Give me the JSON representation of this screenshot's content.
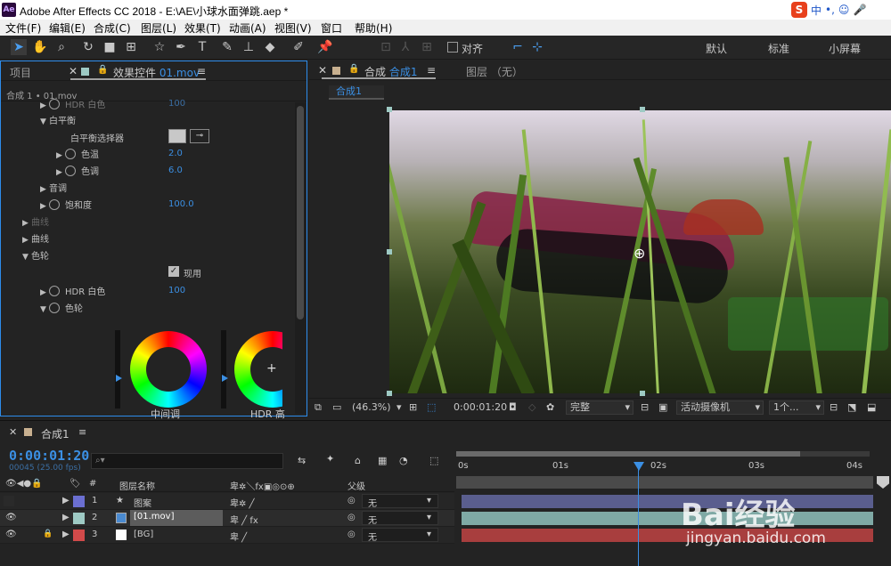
{
  "window": {
    "title": "Adobe After Effects CC 2018 - E:\\AE\\小球水面弹跳.aep *",
    "app_badge": "Ae",
    "ime": {
      "logo": "S",
      "lang": "中",
      "punct": "•,",
      "emoji": "☺",
      "mic": "🎤"
    }
  },
  "menu": [
    "文件(F)",
    "编辑(E)",
    "合成(C)",
    "图层(L)",
    "效果(T)",
    "动画(A)",
    "视图(V)",
    "窗口",
    "帮助(H)"
  ],
  "toolbar": {
    "align_label": "对齐",
    "workspaces": [
      "默认",
      "标准",
      "小屏幕"
    ]
  },
  "left_panel": {
    "tabs": [
      "项目",
      "效果控件 01.mov"
    ],
    "effect_tab_prefix": "效果控件",
    "effect_tab_file": "01.mov",
    "subtitle": "合成 1 • 01.mov",
    "props": [
      {
        "label": "HDR 白色",
        "value": "100"
      },
      {
        "label": "白平衡",
        "value": ""
      },
      {
        "label": "白平衡选择器",
        "value": ""
      },
      {
        "label": "色温",
        "value": "2.0"
      },
      {
        "label": "色调",
        "value": "6.0"
      },
      {
        "label": "音调",
        "value": ""
      },
      {
        "label": "饱和度",
        "value": "100.0"
      },
      {
        "label": "曲线",
        "value": ""
      },
      {
        "label": "曲线",
        "value": ""
      },
      {
        "label": "色轮",
        "value": ""
      },
      {
        "label": "现用",
        "value": ""
      },
      {
        "label": "HDR 白色",
        "value": "100"
      },
      {
        "label": "色轮",
        "value": ""
      }
    ],
    "wheel_labels": [
      "中间调",
      "HDR 高"
    ]
  },
  "comp_panel": {
    "tab_prefix": "合成",
    "tab_name": "合成1",
    "layer_tab": "图层 （无）",
    "subtab": "合成1",
    "zoom": "(46.3%)",
    "timecode": "0:00:01:20",
    "quality": "完整",
    "camera": "活动摄像机",
    "views": "1个..."
  },
  "timeline": {
    "tab": "合成1",
    "timecode": "0:00:01:20",
    "frames": "00045 (25.00 fps)",
    "search_placeholder": "",
    "col_name": "图层名称",
    "col_parent": "父级",
    "col_num": "#",
    "ruler": [
      "0s",
      "01s",
      "02s",
      "03s",
      "04s"
    ],
    "layers": [
      {
        "num": "1",
        "name": "图案",
        "parent": "无",
        "color": "#6b6fd1",
        "bar": "#5a5e8e"
      },
      {
        "num": "2",
        "name": "[01.mov]",
        "parent": "无",
        "color": "#9ecac4",
        "bar": "#7fa9a5"
      },
      {
        "num": "3",
        "name": "[BG]",
        "parent": "无",
        "color": "#d24a4a",
        "bar": "#a83e3e"
      }
    ]
  },
  "watermark": {
    "brand": "Bai经验",
    "url": "jingyan.baidu.com"
  }
}
